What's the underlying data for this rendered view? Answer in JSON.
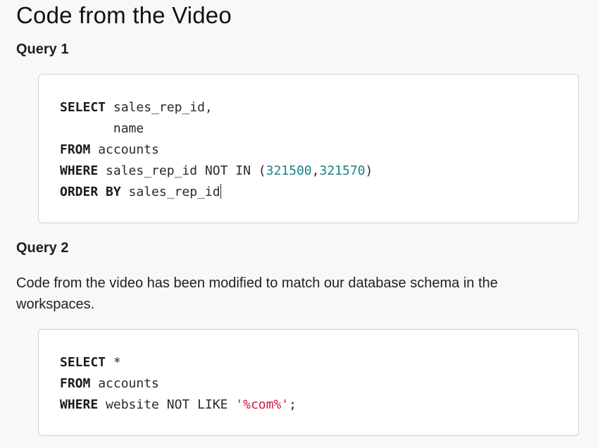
{
  "page": {
    "title": "Code from the Video"
  },
  "query1": {
    "heading": "Query 1",
    "lines": [
      [
        {
          "t": "SELECT",
          "k": "kw"
        },
        {
          "t": " sales_rep_id,",
          "k": "plain"
        }
      ],
      [
        {
          "t": "       name",
          "k": "plain"
        }
      ],
      [
        {
          "t": "FROM",
          "k": "kw"
        },
        {
          "t": " accounts",
          "k": "plain"
        }
      ],
      [
        {
          "t": "WHERE",
          "k": "kw"
        },
        {
          "t": " sales_rep_id ",
          "k": "plain"
        },
        {
          "t": "NOT IN",
          "k": "op"
        },
        {
          "t": " (",
          "k": "plain"
        },
        {
          "t": "321500",
          "k": "num"
        },
        {
          "t": ",",
          "k": "plain"
        },
        {
          "t": "321570",
          "k": "num"
        },
        {
          "t": ")",
          "k": "plain"
        }
      ],
      [
        {
          "t": "ORDER BY",
          "k": "kw"
        },
        {
          "t": " sales_rep_id",
          "k": "plain"
        },
        {
          "t": "",
          "k": "caret"
        }
      ]
    ]
  },
  "query2": {
    "heading": "Query 2",
    "description": "Code from the video has been modified to match our database schema in the workspaces.",
    "lines": [
      [
        {
          "t": "SELECT",
          "k": "kw"
        },
        {
          "t": " *",
          "k": "plain"
        }
      ],
      [
        {
          "t": "FROM",
          "k": "kw"
        },
        {
          "t": " accounts",
          "k": "plain"
        }
      ],
      [
        {
          "t": "WHERE",
          "k": "kw"
        },
        {
          "t": " website ",
          "k": "plain"
        },
        {
          "t": "NOT LIKE",
          "k": "op"
        },
        {
          "t": " ",
          "k": "plain"
        },
        {
          "t": "'%com%'",
          "k": "str"
        },
        {
          "t": ";",
          "k": "plain"
        }
      ]
    ]
  }
}
